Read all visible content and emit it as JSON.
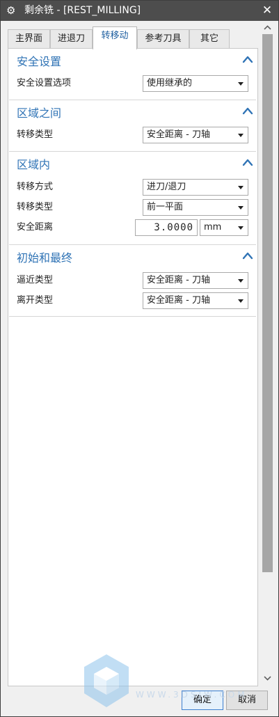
{
  "window": {
    "title": "剩余铣 - [REST_MILLING]"
  },
  "tabs": [
    {
      "label": "主界面",
      "active": false
    },
    {
      "label": "进退刀",
      "active": false
    },
    {
      "label": "转移动",
      "active": true
    },
    {
      "label": "参考刀具",
      "active": false
    },
    {
      "label": "其它",
      "active": false
    }
  ],
  "sections": {
    "safety": {
      "title": "安全设置",
      "rows": [
        {
          "label": "安全设置选项",
          "value": "使用继承的"
        }
      ]
    },
    "between_regions": {
      "title": "区域之间",
      "rows": [
        {
          "label": "转移类型",
          "value": "安全距离 - 刀轴"
        }
      ]
    },
    "within_region": {
      "title": "区域内",
      "transfer_method": {
        "label": "转移方式",
        "value": "进刀/退刀"
      },
      "transfer_type": {
        "label": "转移类型",
        "value": "前一平面"
      },
      "safe_distance": {
        "label": "安全距离",
        "value": "3.0000",
        "unit": "mm"
      }
    },
    "initial_final": {
      "title": "初始和最终",
      "rows": [
        {
          "label": "逼近类型",
          "value": "安全距离 - 刀轴"
        },
        {
          "label": "离开类型",
          "value": "安全距离 - 刀轴"
        }
      ]
    }
  },
  "footer": {
    "ok_label": "确定",
    "cancel_label": "取消"
  },
  "watermark": {
    "text": "WWW.3DSJW.COM"
  },
  "colors": {
    "title_bar": "#4d4d4d",
    "section_title": "#2f73b5",
    "active_tab_text": "#1e5fa0",
    "scroll_thumb": "#a6a6a6"
  },
  "icons": {
    "title": "gear-icon",
    "close": "close-icon",
    "collapse": "chevron-up-icon",
    "dropdown": "triangle-down-icon"
  }
}
